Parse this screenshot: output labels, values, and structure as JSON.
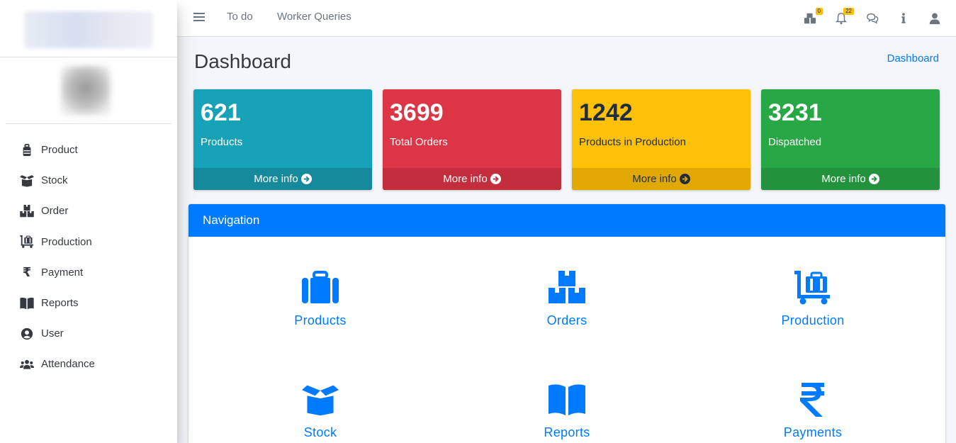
{
  "topbar": {
    "links": [
      "To do",
      "Worker Queries"
    ],
    "notifications_badge": "0",
    "alerts_badge": "22"
  },
  "sidebar": {
    "items": [
      {
        "label": "Product",
        "icon": "briefcase-icon"
      },
      {
        "label": "Stock",
        "icon": "box-open-icon"
      },
      {
        "label": "Order",
        "icon": "boxes-icon"
      },
      {
        "label": "Production",
        "icon": "dolly-flatbed-icon"
      },
      {
        "label": "Payment",
        "icon": "rupee-icon"
      },
      {
        "label": "Reports",
        "icon": "book-open-icon"
      },
      {
        "label": "User",
        "icon": "user-circle-icon"
      },
      {
        "label": "Attendance",
        "icon": "users-icon"
      }
    ]
  },
  "page": {
    "title": "Dashboard",
    "breadcrumb": "Dashboard"
  },
  "stats": [
    {
      "value": "621",
      "label": "Products",
      "footer": "More info",
      "color": "#17a2b8"
    },
    {
      "value": "3699",
      "label": "Total Orders",
      "footer": "More info",
      "color": "#dc3545"
    },
    {
      "value": "1242",
      "label": "Products in Production",
      "footer": "More info",
      "color": "#ffc107"
    },
    {
      "value": "3231",
      "label": "Dispatched",
      "footer": "More info",
      "color": "#28a745"
    }
  ],
  "navigation": {
    "title": "Navigation",
    "tiles": [
      {
        "label": "Products",
        "icon": "briefcase-icon"
      },
      {
        "label": "Orders",
        "icon": "boxes-icon"
      },
      {
        "label": "Production",
        "icon": "dolly-flatbed-icon"
      },
      {
        "label": "Stock",
        "icon": "box-open-icon"
      },
      {
        "label": "Reports",
        "icon": "book-open-icon"
      },
      {
        "label": "Payments",
        "icon": "rupee-icon"
      }
    ]
  },
  "colors": {
    "primary": "#007bff",
    "sidebar_text": "#343a40"
  }
}
